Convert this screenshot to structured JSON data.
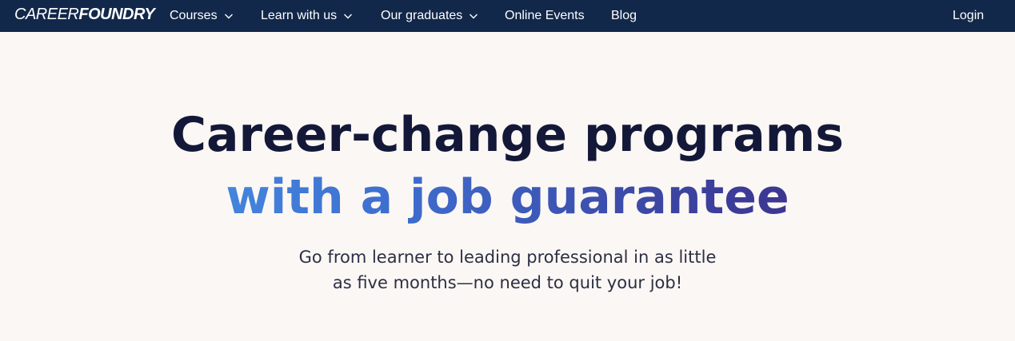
{
  "brand": {
    "logo_light": "CAREER",
    "logo_bold": "FOUNDRY"
  },
  "nav": {
    "courses": "Courses",
    "learn": "Learn with us",
    "graduates": "Our graduates",
    "events": "Online Events",
    "blog": "Blog",
    "login": "Login"
  },
  "hero": {
    "headline_line1": "Career-change programs",
    "headline_line2": "with a job guarantee",
    "subtitle_line1": "Go from learner to leading professional in as little",
    "subtitle_line2": "as five months—no need to quit your job!"
  },
  "colors": {
    "nav_bg": "#12284a",
    "page_bg": "#fbf7f4",
    "headline": "#141838",
    "gradient_start": "#4aa3ee",
    "gradient_end": "#3a1b72"
  },
  "icons": {
    "dropdown": "chevron-down-icon"
  }
}
